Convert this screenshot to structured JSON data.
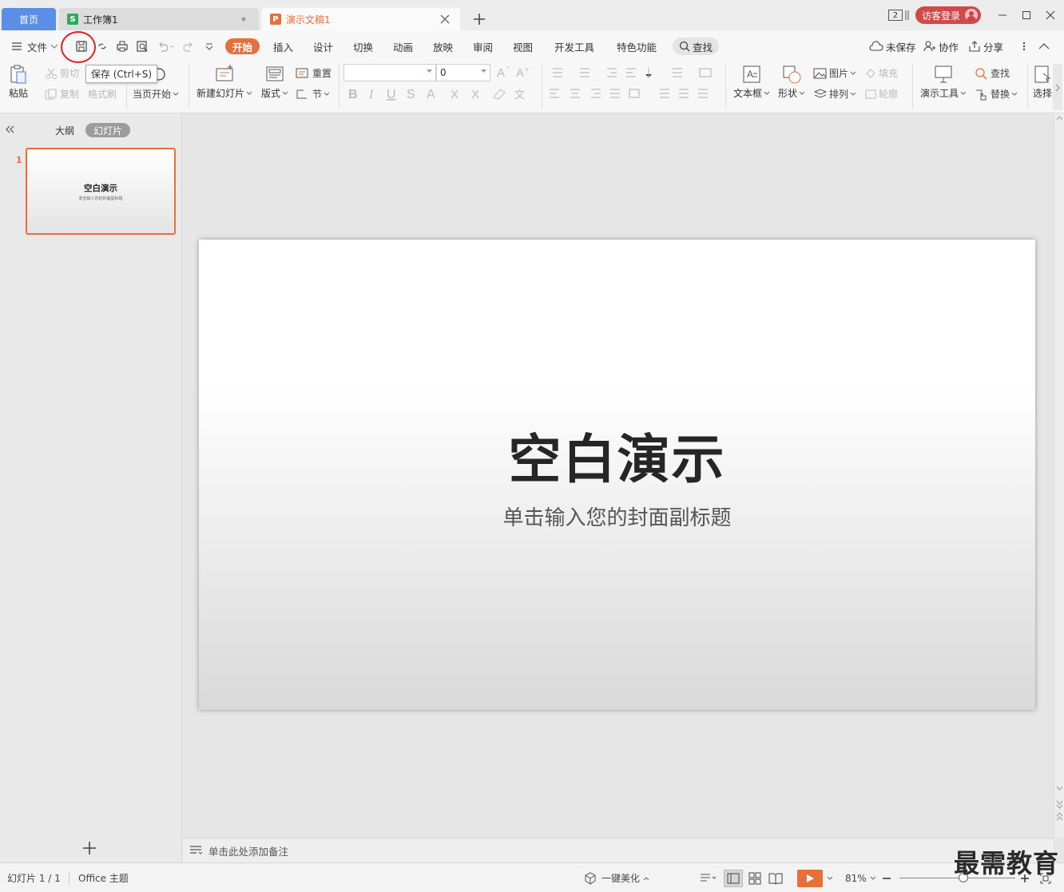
{
  "tabs": {
    "home": "首页",
    "workbook": "工作簿1",
    "presentation": "演示文稿1",
    "workbook_icon": "S",
    "presentation_icon": "P"
  },
  "window": {
    "badge": "2",
    "login": "访客登录"
  },
  "menu": {
    "file": "文件",
    "tabs": [
      "开始",
      "插入",
      "设计",
      "切换",
      "动画",
      "放映",
      "审阅",
      "视图",
      "开发工具",
      "特色功能"
    ],
    "search": "查找",
    "unsaved": "未保存",
    "collab": "协作",
    "share": "分享"
  },
  "tooltip": "保存 (Ctrl+S)",
  "ribbon": {
    "paste": "粘贴",
    "cut": "剪切",
    "copy": "复制",
    "format_painter": "格式刷",
    "from_current": "当页开始",
    "new_slide": "新建幻灯片",
    "layout": "版式",
    "reset": "重置",
    "section": "节",
    "font_size": "0",
    "text_box": "文本框",
    "shape": "形状",
    "picture": "图片",
    "fill": "填充",
    "arrange": "排列",
    "outline": "轮廓",
    "present_tools": "演示工具",
    "find": "查找",
    "replace": "替换",
    "select": "选择"
  },
  "panel": {
    "outline_tab": "大纲",
    "slides_tab": "幻灯片",
    "slide_number": "1",
    "thumb_title": "空白演示",
    "thumb_sub": "单击输入您的封面副标题"
  },
  "slide": {
    "title": "空白演示",
    "subtitle": "单击输入您的封面副标题"
  },
  "notes_placeholder": "单击此处添加备注",
  "status": {
    "slide_count": "幻灯片 1 / 1",
    "theme": "Office 主题",
    "beautify": "一键美化",
    "zoom": "81%",
    "zoom_level": 0.55
  },
  "watermark": "最需教育",
  "colors": {
    "accent": "#e5703b",
    "home_tab": "#5b8ee6",
    "login": "#d04a4a"
  }
}
